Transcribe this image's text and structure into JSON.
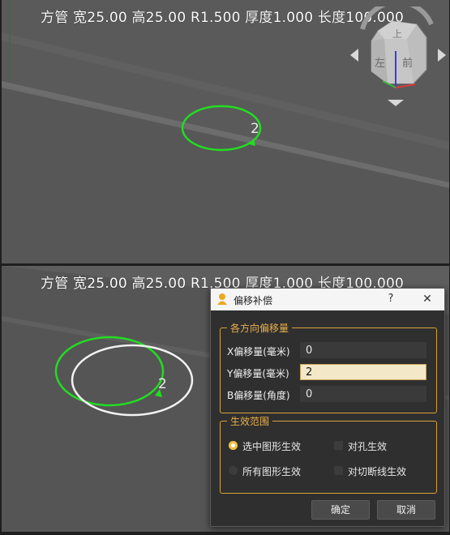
{
  "viewport_top": {
    "header": "方管 宽25.00 高25.00 R1.500 厚度1.000 长度100.000",
    "marker_label": "2"
  },
  "viewport_bottom": {
    "header": "方管 宽25.00 高25.00 R1.500 厚度1.000 长度100.000",
    "marker_label": "2"
  },
  "view_cube": {
    "faces": [
      "上",
      "左",
      "前"
    ]
  },
  "dialog": {
    "title": "偏移补偿",
    "help": "?",
    "close": "✕",
    "offset_group": {
      "title": "各方向偏移量",
      "rows": [
        {
          "label": "X偏移量(毫米)",
          "value": "0"
        },
        {
          "label": "Y偏移量(毫米)",
          "value": "2"
        },
        {
          "label": "B偏移量(角度)",
          "value": "0"
        }
      ]
    },
    "scope_group": {
      "title": "生效范围",
      "options": [
        {
          "label": "选中图形生效",
          "kind": "radio",
          "checked": true
        },
        {
          "label": "对孔生效",
          "kind": "checkbox",
          "checked": false
        },
        {
          "label": "所有图形生效",
          "kind": "radio",
          "checked": false
        },
        {
          "label": "对切断线生效",
          "kind": "checkbox",
          "checked": false
        }
      ]
    },
    "ok_label": "确定",
    "cancel_label": "取消"
  },
  "colors": {
    "accent": "#e9b04a",
    "selected_contour": "#22dd22",
    "offset_contour": "#f2f2f2"
  }
}
